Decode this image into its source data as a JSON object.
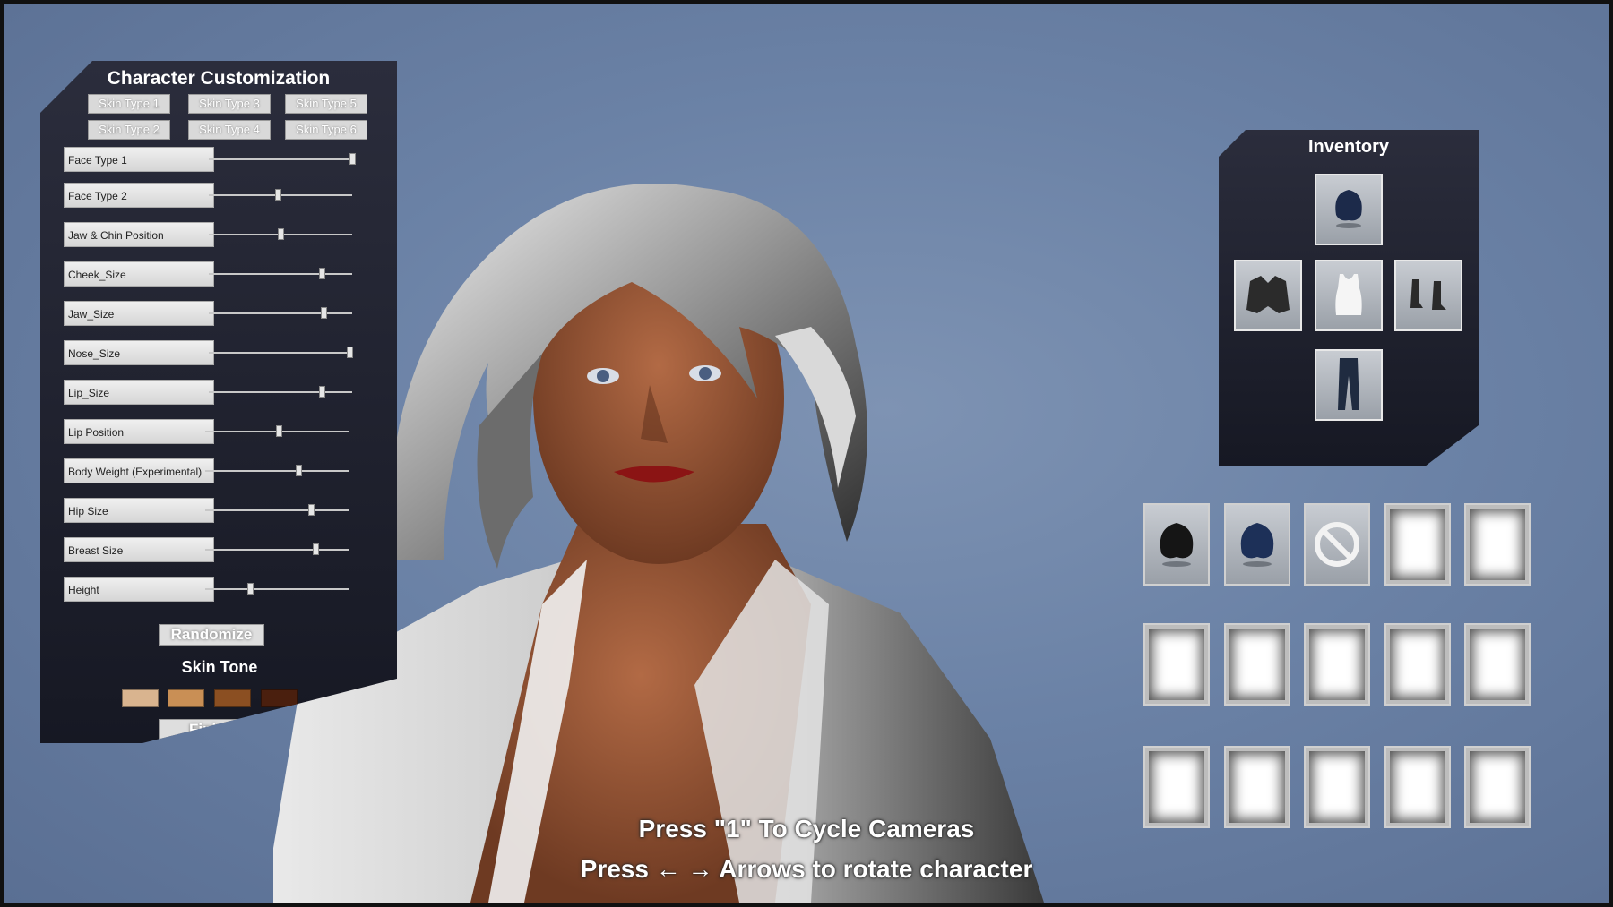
{
  "customization": {
    "title": "Character Customization",
    "skin_types": [
      "Skin Type 1",
      "Skin Type 3",
      "Skin Type 5",
      "Skin Type 2",
      "Skin Type 4",
      "Skin Type 6"
    ],
    "sliders": [
      {
        "label": "Face Type 1",
        "value": 1.0
      },
      {
        "label": "Face Type 2",
        "value": 0.48
      },
      {
        "label": "Jaw & Chin Position",
        "value": 0.5
      },
      {
        "label": "Cheek_Size",
        "value": 0.79
      },
      {
        "label": "Jaw_Size",
        "value": 0.8
      },
      {
        "label": "Nose_Size",
        "value": 0.98
      },
      {
        "label": "Lip_Size",
        "value": 0.79
      },
      {
        "label": "Lip Position",
        "value": 0.51
      },
      {
        "label": "Body Weight (Experimental)",
        "value": 0.65
      },
      {
        "label": "Hip Size",
        "value": 0.74
      },
      {
        "label": "Breast Size",
        "value": 0.77
      },
      {
        "label": "Height",
        "value": 0.31
      }
    ],
    "randomize_label": "Randomize",
    "skin_tone_title": "Skin Tone",
    "skin_tones": [
      "#d9b48f",
      "#c98f55",
      "#8b4f22",
      "#4a1f0e"
    ],
    "finish_label": "Finish"
  },
  "inventory": {
    "title": "Inventory",
    "equipped": [
      {
        "slot": "head",
        "icon": "hair-icon"
      },
      {
        "slot": "jacket",
        "icon": "jacket-icon"
      },
      {
        "slot": "top",
        "icon": "tank-top-icon"
      },
      {
        "slot": "boots",
        "icon": "boots-icon"
      },
      {
        "slot": "pants",
        "icon": "pants-icon"
      }
    ],
    "bag": [
      {
        "icon": "dark-hair-icon"
      },
      {
        "icon": "blue-hair-icon"
      },
      {
        "icon": "none-icon"
      },
      {
        "icon": "empty"
      },
      {
        "icon": "empty"
      },
      {
        "icon": "empty"
      },
      {
        "icon": "empty"
      },
      {
        "icon": "empty"
      },
      {
        "icon": "empty"
      },
      {
        "icon": "empty"
      },
      {
        "icon": "empty"
      },
      {
        "icon": "empty"
      },
      {
        "icon": "empty"
      },
      {
        "icon": "empty"
      },
      {
        "icon": "empty"
      }
    ]
  },
  "hints": {
    "cameras": "Press \"1\" To Cycle Cameras",
    "rotate": "Press ← → Arrows to rotate character"
  }
}
